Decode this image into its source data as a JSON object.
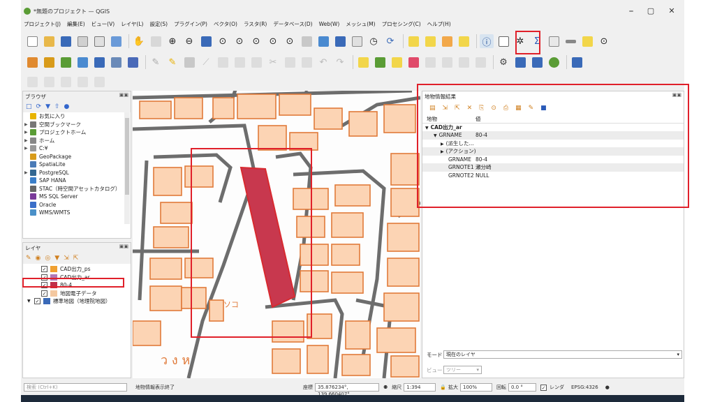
{
  "window": {
    "title": "*無題のプロジェクト — QGIS",
    "minimize": "⎯",
    "maximize": "▢",
    "close": "✕"
  },
  "menu": [
    "プロジェクト(J)",
    "編集(E)",
    "ビュー(V)",
    "レイヤ(L)",
    "設定(S)",
    "プラグイン(P)",
    "ベクタ(O)",
    "ラスタ(R)",
    "データベース(D)",
    "Web(W)",
    "メッシュ(M)",
    "プロセシング(C)",
    "ヘルプ(H)"
  ],
  "browser": {
    "title": "ブラウザ",
    "items": [
      {
        "label": "お気に入り",
        "icon": "star-icon",
        "color": "#e8b400",
        "arrow": ""
      },
      {
        "label": "空間ブックマーク",
        "icon": "bookmark-icon",
        "color": "#777777",
        "arrow": "▶"
      },
      {
        "label": "プロジェクトホーム",
        "icon": "folder-green-icon",
        "color": "#5a9c35",
        "arrow": "▶"
      },
      {
        "label": "ホーム",
        "icon": "home-icon",
        "color": "#888888",
        "arrow": "▶"
      },
      {
        "label": "C:¥",
        "icon": "drive-icon",
        "color": "#999999",
        "arrow": "▶"
      },
      {
        "label": "GeoPackage",
        "icon": "geopackage-icon",
        "color": "#d89b1a",
        "arrow": ""
      },
      {
        "label": "SpatiaLite",
        "icon": "spatialite-icon",
        "color": "#4a7bb7",
        "arrow": ""
      },
      {
        "label": "PostgreSQL",
        "icon": "postgresql-icon",
        "color": "#336791",
        "arrow": "▶"
      },
      {
        "label": "SAP HANA",
        "icon": "sap-icon",
        "color": "#3a7ec8",
        "arrow": ""
      },
      {
        "label": "STAC（時空間アセットカタログ）",
        "icon": "stac-icon",
        "color": "#666666",
        "arrow": ""
      },
      {
        "label": "MS SQL Server",
        "icon": "mssql-icon",
        "color": "#7a3a9a",
        "arrow": ""
      },
      {
        "label": "Oracle",
        "icon": "oracle-icon",
        "color": "#3a6ec8",
        "arrow": ""
      },
      {
        "label": "WMS/WMTS",
        "icon": "wms-icon",
        "color": "#4a90c8",
        "arrow": ""
      }
    ]
  },
  "layers": {
    "title": "レイヤ",
    "items": [
      {
        "label": "CAD出力_ps",
        "checked": "✓",
        "swatch": "#f0a030",
        "indent": 10,
        "expand": ""
      },
      {
        "label": "CAD出力_ar",
        "checked": "✓",
        "swatch": "#b07ab8",
        "indent": 10,
        "expand": ""
      },
      {
        "label": "80-4",
        "checked": "✓",
        "swatch": "#c0304a",
        "indent": 10,
        "expand": ""
      },
      {
        "label": "地図電子データ",
        "checked": "✓",
        "swatch": "#f4c8a0",
        "indent": 10,
        "expand": ""
      },
      {
        "label": "標準地図（地理院地図）",
        "checked": "✓",
        "swatch": "#3a6ab8",
        "indent": 0,
        "expand": "▼"
      }
    ]
  },
  "identify": {
    "title": "地物情報結果",
    "col_feature": "地物",
    "col_value": "値",
    "rows": [
      {
        "key": "CAD出力_ar",
        "value": "",
        "indent": 4,
        "arrow": "▼",
        "bold": true,
        "shade": false
      },
      {
        "key": "GRNAME",
        "value": "80-4",
        "indent": 16,
        "arrow": "▼",
        "bold": false,
        "shade": true
      },
      {
        "key": "(派生した...",
        "value": "",
        "indent": 26,
        "arrow": "▶",
        "bold": false,
        "shade": false
      },
      {
        "key": "(アクション)",
        "value": "",
        "indent": 26,
        "arrow": "▶",
        "bold": false,
        "shade": true
      },
      {
        "key": "GRNAME",
        "value": "80-4",
        "indent": 34,
        "arrow": "",
        "bold": false,
        "shade": false
      },
      {
        "key": "GRNOTE1",
        "value": "瀬分崎",
        "indent": 34,
        "arrow": "",
        "bold": false,
        "shade": true
      },
      {
        "key": "GRNOTE2",
        "value": "NULL",
        "indent": 34,
        "arrow": "",
        "bold": false,
        "shade": false
      }
    ],
    "mode_label": "モード",
    "mode_value": "現在のレイヤ",
    "view_label": "ビュー",
    "view_value": "ツリー"
  },
  "status": {
    "search_placeholder": "検索 (Ctrl+K)",
    "message": "地物情報表示終了",
    "coord_label": "座標",
    "coord_value": "35.876234°, 139.660407°",
    "scale_label": "縮尺",
    "scale_value": "1:394",
    "magnifier_label": "拡大",
    "magnifier_value": "100%",
    "rotation_label": "回転",
    "rotation_value": "0.0 °",
    "render_label": "レンダ",
    "crs_label": "EPSG:4326"
  }
}
